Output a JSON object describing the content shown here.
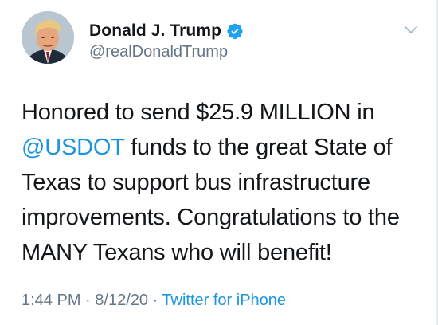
{
  "author": {
    "display_name": "Donald J. Trump",
    "handle": "@realDonaldTrump",
    "verified": true,
    "avatar_icon": "avatar-portrait"
  },
  "tweet": {
    "text_lines": [
      {
        "before": "Honored to send $25.9 MILLION in",
        "mention": "",
        "after": ""
      },
      {
        "before": "",
        "mention": "@USDOT",
        "after": " funds to the great State of"
      },
      {
        "before": "Texas to support bus infrastructure",
        "mention": "",
        "after": ""
      },
      {
        "before": "improvements. Congratulations to the",
        "mention": "",
        "after": ""
      },
      {
        "before": "MANY Texans who will benefit!",
        "mention": "",
        "after": ""
      }
    ]
  },
  "meta": {
    "time": "1:44 PM",
    "separator": " · ",
    "date": "8/12/20",
    "source": "Twitter for iPhone"
  },
  "colors": {
    "link": "#1b95e0",
    "secondary_text": "#657786",
    "primary_text": "#14171a",
    "verified_badge": "#1da1f2"
  },
  "icons": {
    "verified": "verified-badge-icon",
    "menu": "chevron-down-icon"
  }
}
